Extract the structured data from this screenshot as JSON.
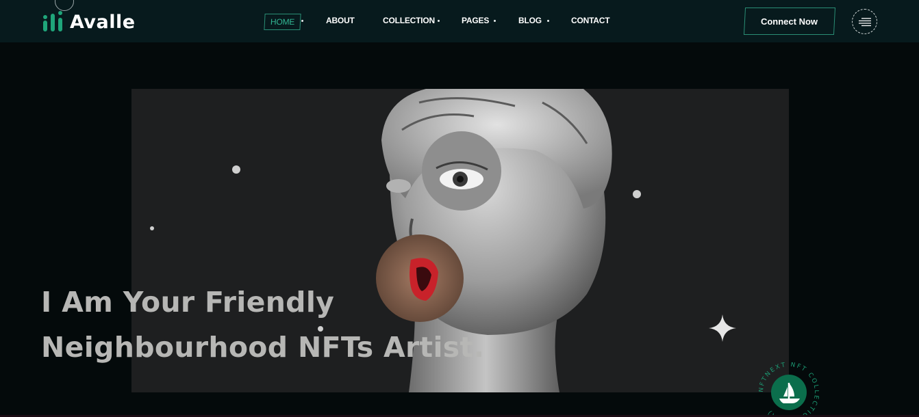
{
  "brand": {
    "name": "Avalle",
    "accent": "#1fa57a"
  },
  "nav": {
    "items": [
      {
        "label": "HOME",
        "active": true,
        "has_dropdown": true
      },
      {
        "label": "ABOUT",
        "active": false,
        "has_dropdown": false
      },
      {
        "label": "COLLECTION",
        "active": false,
        "has_dropdown": true
      },
      {
        "label": "PAGES",
        "active": false,
        "has_dropdown": true
      },
      {
        "label": "BLOG",
        "active": false,
        "has_dropdown": true
      },
      {
        "label": "CONTACT",
        "active": false,
        "has_dropdown": false
      }
    ]
  },
  "header": {
    "connect_label": "Connect Now",
    "menu_icon": "hamburger-menu-icon"
  },
  "hero": {
    "title_line1": "I Am Your Friendly",
    "title_line2": "Neighbourhood NFTs Artist.",
    "image": "statue-collage-image"
  },
  "badge": {
    "ring_text": "NFTNEXT NFT COLLECTION (ARA)",
    "icon": "opensea-ship-icon"
  }
}
